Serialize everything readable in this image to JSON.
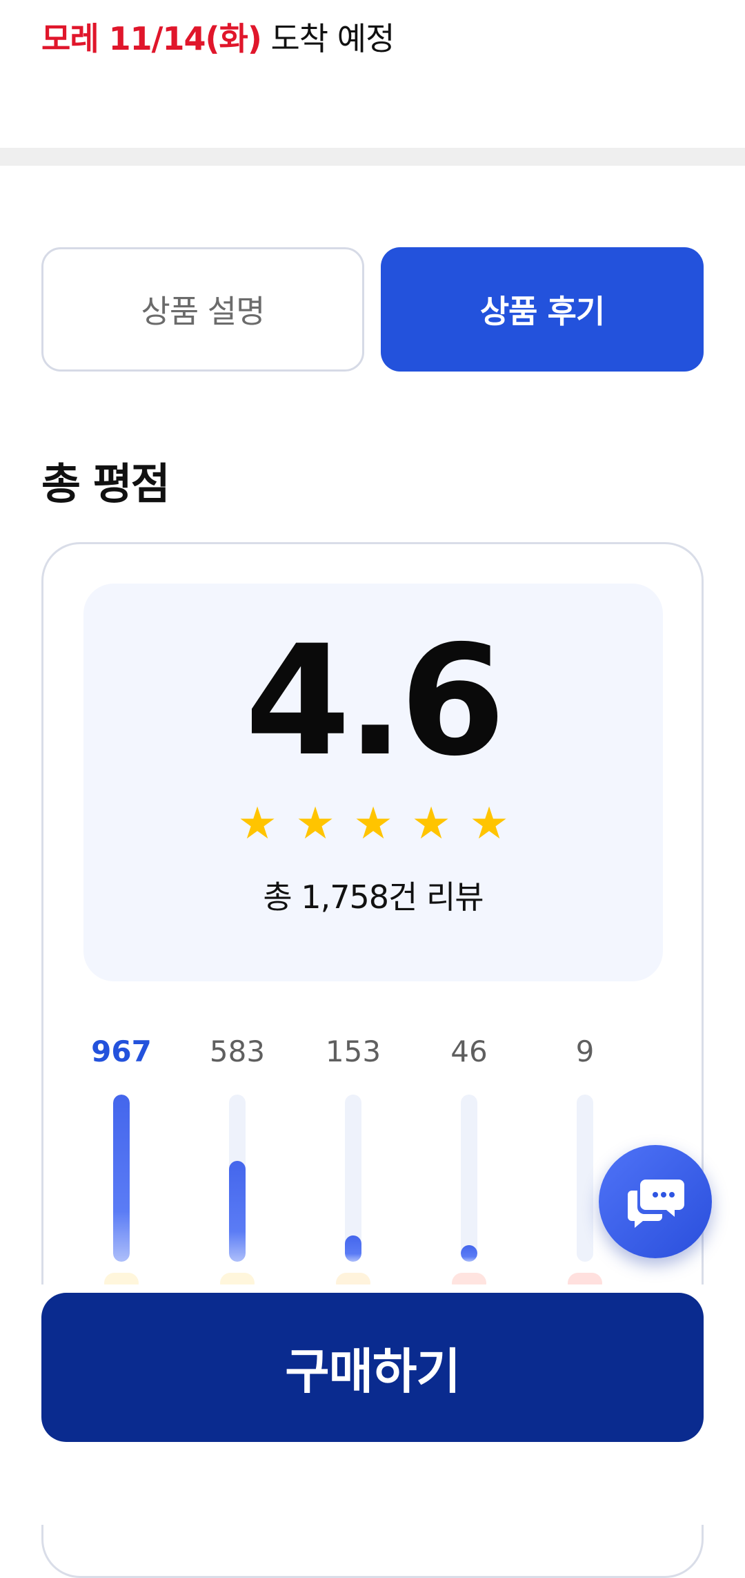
{
  "delivery": {
    "date": "모레 11/14(화)",
    "rest": " 도착 예정"
  },
  "tabs": {
    "description": "상품 설명",
    "reviews": "상품 후기",
    "active": "reviews"
  },
  "rating": {
    "title": "총 평점",
    "score": "4.6",
    "review_count": "총 1,758건 리뷰",
    "stars": 5
  },
  "distribution": [
    {
      "count": "967",
      "value": 967,
      "active": true
    },
    {
      "count": "583",
      "value": 583,
      "active": false
    },
    {
      "count": "153",
      "value": 153,
      "active": false
    },
    {
      "count": "46",
      "value": 46,
      "active": false
    },
    {
      "count": "9",
      "value": 9,
      "active": false
    }
  ],
  "colors": {
    "accent": "#2352dc",
    "primary_button": "#0a2b8f",
    "delivery_date": "#e0162b",
    "star": "#ffc400"
  },
  "icons": {
    "star": "star-icon",
    "chat": "chat-icon"
  },
  "buy_button": {
    "label": "구매하기"
  }
}
